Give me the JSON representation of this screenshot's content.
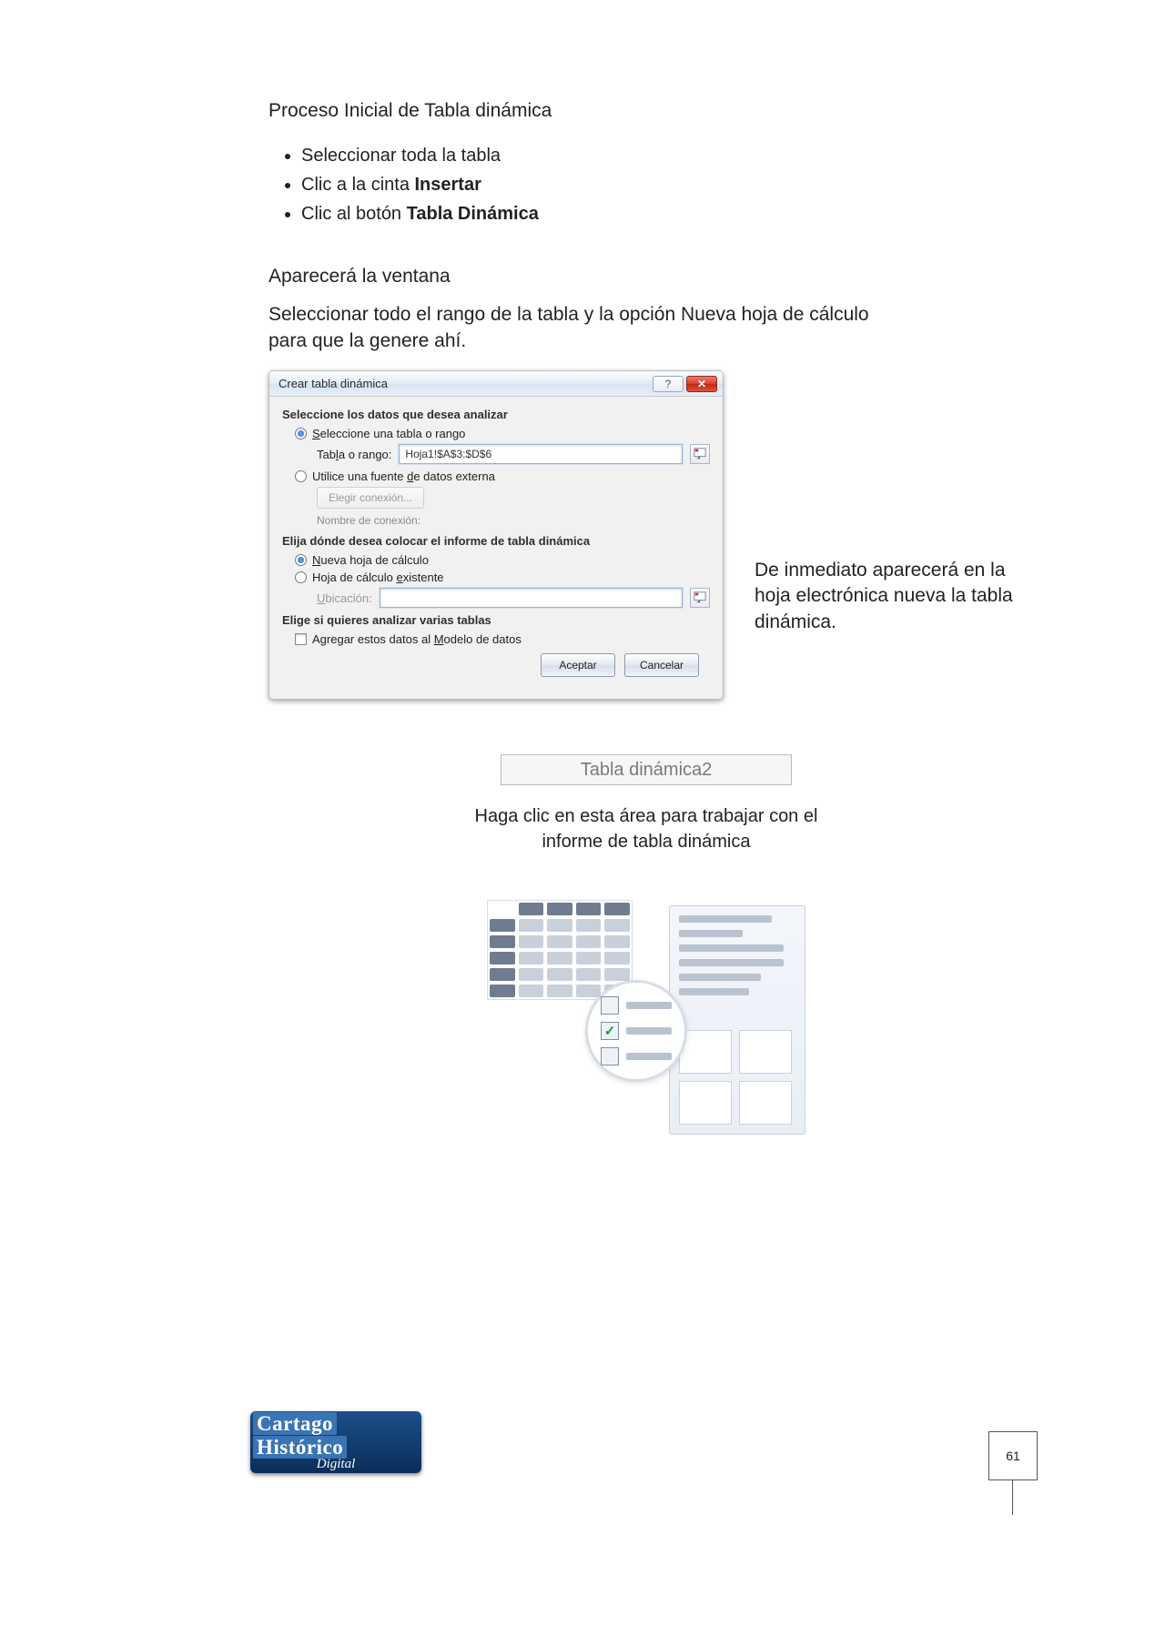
{
  "title": "Proceso Inicial de Tabla dinámica",
  "steps": {
    "s1": "Seleccionar toda la tabla",
    "s2_pre": "Clic a la cinta ",
    "s2_b": "Insertar",
    "s3_pre": "Clic al botón ",
    "s3_b": "Tabla Dinámica"
  },
  "sub1": "Aparecerá la ventana",
  "sub2": "Seleccionar todo el rango de la tabla y la opción Nueva hoja de cálculo para que la genere ahí.",
  "dialog": {
    "title": "Crear tabla dinámica",
    "help": "?",
    "close": "✕",
    "sec1": "Seleccione los datos que desea analizar",
    "opt1_pre": "S",
    "opt1_rest": "eleccione una tabla o rango",
    "range_label_pre": "Tab",
    "range_label_u": "l",
    "range_label_post": "a o rango:",
    "range_value": "Hoja1!$A$3:$D$6",
    "opt2_pre": "Utilice una fuente ",
    "opt2_u": "d",
    "opt2_post": "e datos externa",
    "choose_conn": "Elegir conexión...",
    "conn_name": "Nombre de conexión:",
    "sec2": "Elija dónde desea colocar el informe de tabla dinámica",
    "opt3_u": "N",
    "opt3_post": "ueva hoja de cálculo",
    "opt4_pre": "Hoja de cálculo ",
    "opt4_u": "e",
    "opt4_post": "xistente",
    "loc_u": "U",
    "loc_post": "bicación:",
    "sec3": "Elige si quieres analizar varias tablas",
    "chk_pre": "Agregar estos datos al ",
    "chk_u": "M",
    "chk_post": "odelo de datos",
    "ok": "Aceptar",
    "cancel": "Cancelar"
  },
  "side_note": "De inmediato aparecerá en la hoja electrónica nueva la tabla dinámica.",
  "pivot": {
    "name": "Tabla dinámica2",
    "hint": "Haga clic en esta área para trabajar con el informe de tabla dinámica"
  },
  "logo": {
    "w1": "Cartago",
    "w2": "Histórico",
    "w3": "Digital"
  },
  "page_number": "61"
}
